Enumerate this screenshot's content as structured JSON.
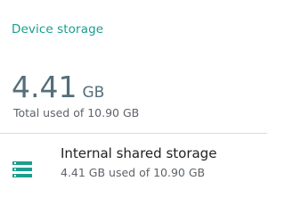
{
  "section": {
    "title": "Device storage"
  },
  "summary": {
    "used_value": "4.41",
    "used_unit": "GB",
    "caption": "Total used of 10.90 GB"
  },
  "storage_items": [
    {
      "title": "Internal shared storage",
      "subtitle": "4.41 GB used of 10.90 GB",
      "icon": "storage-icon"
    }
  ],
  "colors": {
    "accent": "#1a9e8f",
    "summary_text": "#546e7a",
    "secondary_text": "#5f6368",
    "primary_text": "#212121",
    "divider": "#dcdcdc"
  }
}
